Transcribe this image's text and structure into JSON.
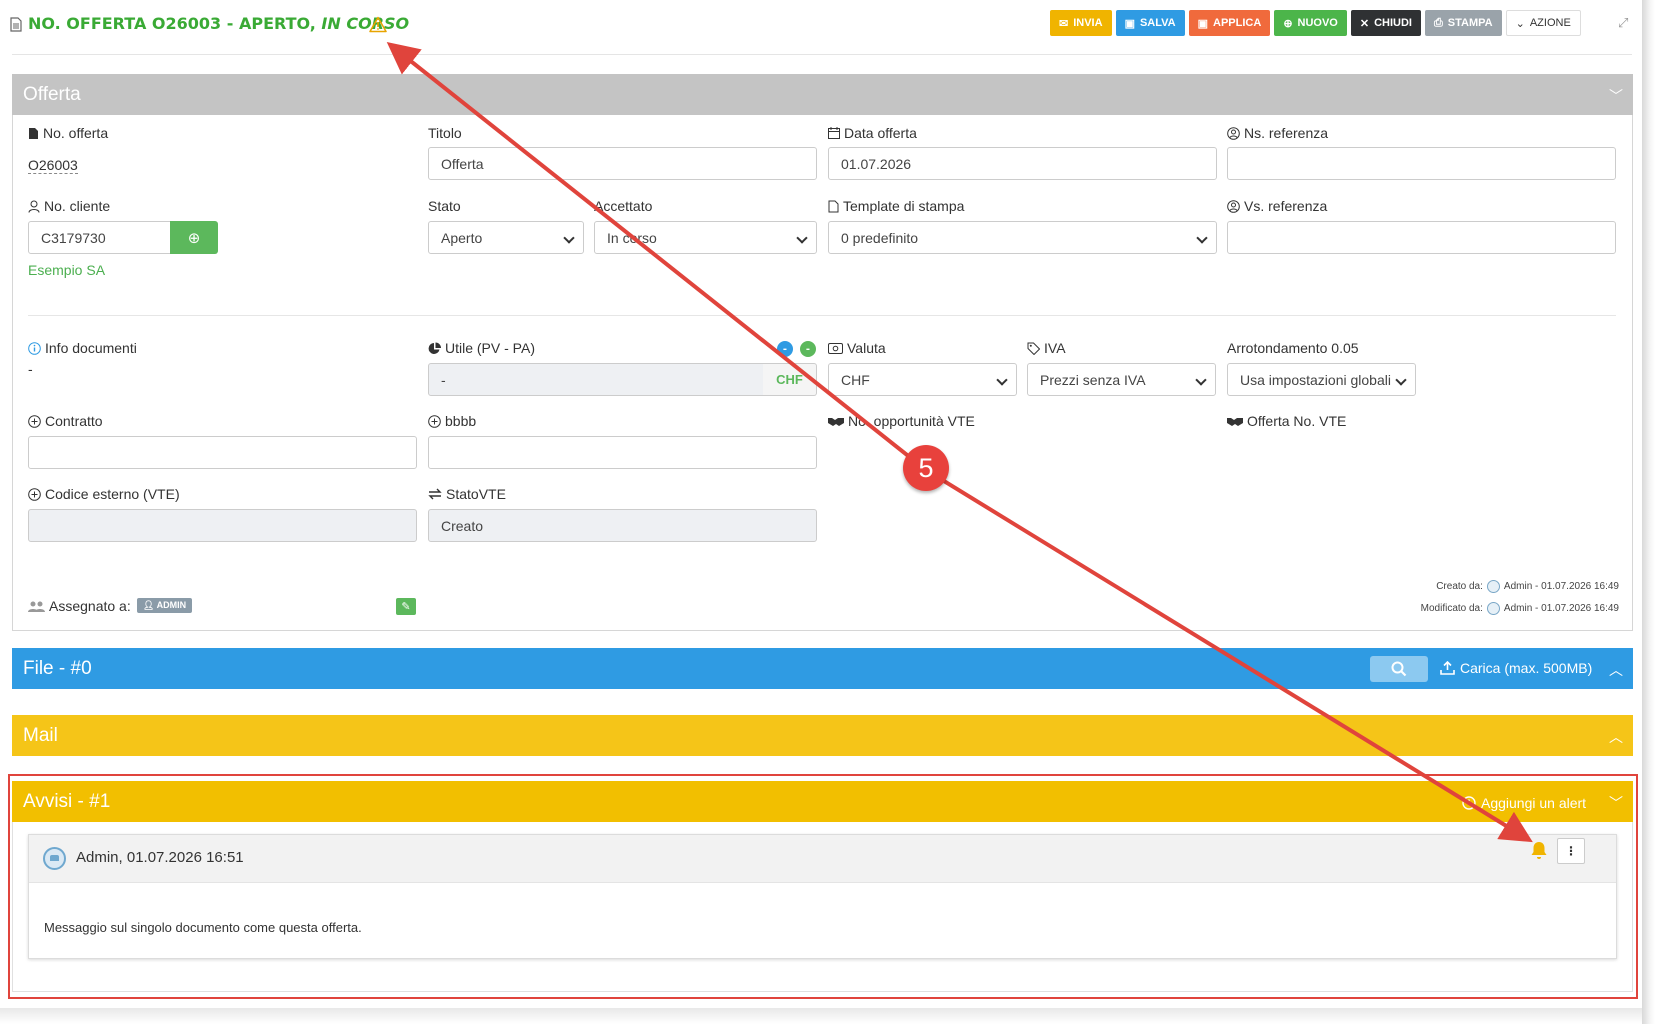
{
  "header": {
    "title_main": "NO. OFFERTA O26003 - APERTO, ",
    "title_status": "IN CORSO"
  },
  "toolbar": {
    "invia": "INVIA",
    "salva": "SALVA",
    "applica": "APPLICA",
    "nuovo": "NUOVO",
    "chiudi": "CHIUDI",
    "stampa": "STAMPA",
    "azione": "AZIONE"
  },
  "colors": {
    "invia": "#f0b400",
    "salva": "#2f9be3",
    "applica": "#f06a3c",
    "nuovo": "#4cb54a",
    "chiudi": "#2f3133",
    "stampa": "#9aa3aa"
  },
  "offerta": {
    "panel_title": "Offerta",
    "no_offerta_label": "No. offerta",
    "no_offerta_value": "O26003",
    "titolo_label": "Titolo",
    "titolo_value": "Offerta",
    "data_label": "Data offerta",
    "data_value": "01.07.2026",
    "ns_ref_label": "Ns. referenza",
    "ns_ref_value": "",
    "no_cliente_label": "No. cliente",
    "no_cliente_value": "C3179730",
    "cliente_name": "Esempio SA",
    "stato_label": "Stato",
    "stato_value": "Aperto",
    "accettato_label": "Accettato",
    "accettato_value": "In corso",
    "template_label": "Template di stampa",
    "template_value": "0 predefinito",
    "vs_ref_label": "Vs. referenza",
    "vs_ref_value": "",
    "info_label": "Info documenti",
    "info_value": "-",
    "utile_label": "Utile (PV - PA)",
    "utile_value": "-",
    "utile_currency": "CHF",
    "dot_blue": "-",
    "dot_green": "-",
    "valuta_label": "Valuta",
    "valuta_value": "CHF",
    "iva_label": "IVA",
    "iva_value": "Prezzi senza IVA",
    "arrot_label": "Arrotondamento 0.05",
    "arrot_value": "Usa impostazioni globali",
    "contratto_label": "Contratto",
    "bbbb_label": "bbbb",
    "opport_label": "No. opportunità VTE",
    "offerta_vte_label": "Offerta No. VTE",
    "codice_label": "Codice esterno (VTE)",
    "stato_vte_label": "StatoVTE",
    "stato_vte_value": "Creato",
    "assegnato_label": "Assegnato a:",
    "assegnato_badge": "ADMIN",
    "creato_text": "Creato da:",
    "creato_value": "Admin - 01.07.2026 16:49",
    "modificato_text": "Modificato da:",
    "modificato_value": "Admin - 01.07.2026 16:49"
  },
  "file_panel": {
    "title": "File - #0",
    "upload": "Carica (max. 500MB)"
  },
  "mail_panel": {
    "title": "Mail"
  },
  "avvisi_panel": {
    "title": "Avvisi - #1",
    "add_alert": "Aggiungi un alert",
    "note_author": "Admin, 01.07.2026 16:51",
    "note_text": "Messaggio sul singolo documento come questa offerta."
  },
  "annotation": {
    "step_number": "5"
  }
}
